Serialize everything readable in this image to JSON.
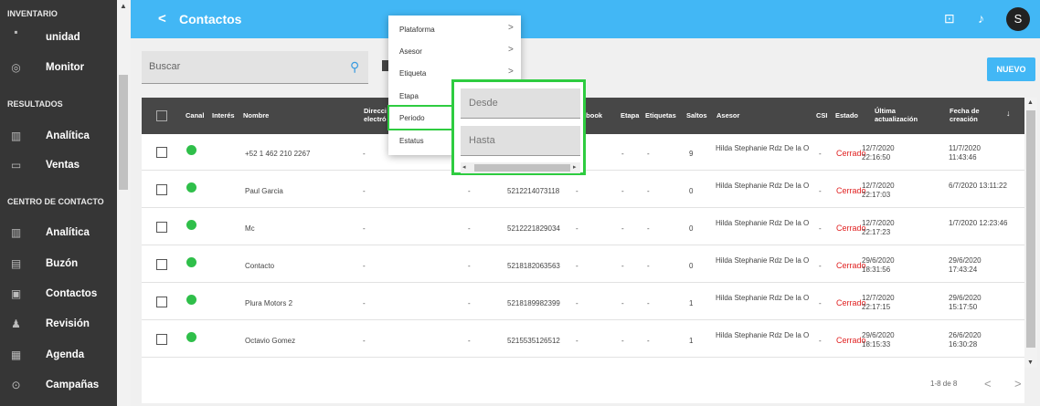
{
  "sidebar": {
    "sections": {
      "inventario": "INVENTARIO",
      "resultados": "RESULTADOS",
      "centro": "CENTRO DE CONTACTO"
    },
    "items": [
      {
        "label": "unidad",
        "icon": "unit-icon"
      },
      {
        "label": "Monitor",
        "icon": "monitor-icon"
      },
      {
        "label": "Analítica",
        "icon": "analytics-icon"
      },
      {
        "label": "Ventas",
        "icon": "car-icon"
      },
      {
        "label": "Analítica",
        "icon": "analytics-icon"
      },
      {
        "label": "Buzón",
        "icon": "inbox-icon"
      },
      {
        "label": "Contactos",
        "icon": "contacts-icon"
      },
      {
        "label": "Revisión",
        "icon": "review-icon"
      },
      {
        "label": "Agenda",
        "icon": "calendar-icon"
      },
      {
        "label": "Campañas",
        "icon": "campaign-icon"
      }
    ]
  },
  "header": {
    "back": "<",
    "title": "Contactos",
    "avatar": "S",
    "accent": "#42b7f5"
  },
  "search": {
    "placeholder": "Buscar"
  },
  "actions": {
    "new": "NUEVO"
  },
  "filter_menu": {
    "items": [
      {
        "label": "Plataforma",
        "chevron": ">"
      },
      {
        "label": "Asesor",
        "chevron": ">"
      },
      {
        "label": "Etiqueta",
        "chevron": ">"
      },
      {
        "label": "Etapa",
        "chevron": ""
      },
      {
        "label": "Periodo",
        "chevron": ""
      },
      {
        "label": "Estatus",
        "chevron": ""
      }
    ],
    "selected": "Periodo"
  },
  "period_submenu": {
    "from": "Desde",
    "to": "Hasta"
  },
  "table": {
    "headers": {
      "canal": "Canal",
      "interes": "Interés",
      "nombre": "Nombre",
      "direccion1": "Direcci",
      "direccion2": "electró",
      "facebook": "ebook",
      "etapa": "Etapa",
      "etiquetas": "Etiquetas",
      "saltos": "Saltos",
      "asesor": "Asesor",
      "csi": "CSI",
      "estado": "Estado",
      "ultima1": "Última",
      "ultima2": "actualización",
      "fecha1": "Fecha de",
      "fecha2": "creación"
    },
    "rows": [
      {
        "nombre": "+52 1 462 210 2267",
        "dir": "-",
        "tel": "",
        "tel_dash": "",
        "etapa": "-",
        "etiq": "-",
        "saltos": "9",
        "asesor": "Hilda Stephanie Rdz De la O",
        "csi": "-",
        "estado": "Cerrado",
        "upd_date": "12/7/2020",
        "upd_time": "22:16:50",
        "cre_date": "11/7/2020",
        "cre_time": "11:43:46"
      },
      {
        "nombre": "Paul Garcia",
        "dir": "-",
        "tel": "5212214073118",
        "tel_dash": "-",
        "etapa": "-",
        "etiq": "-",
        "saltos": "0",
        "asesor": "Hilda Stephanie Rdz De la O",
        "csi": "-",
        "estado": "Cerrado",
        "upd_date": "12/7/2020",
        "upd_time": "22:17:03",
        "cre_date": "6/7/2020 13:11:22",
        "cre_time": ""
      },
      {
        "nombre": "Mc",
        "dir": "-",
        "tel": "5212221829034",
        "tel_dash": "-",
        "etapa": "-",
        "etiq": "-",
        "saltos": "0",
        "asesor": "Hilda Stephanie Rdz De la O",
        "csi": "-",
        "estado": "Cerrado",
        "upd_date": "12/7/2020",
        "upd_time": "22:17:23",
        "cre_date": "1/7/2020 12:23:46",
        "cre_time": ""
      },
      {
        "nombre": "Contacto",
        "dir": "-",
        "tel": "5218182063563",
        "tel_dash": "-",
        "etapa": "-",
        "etiq": "-",
        "saltos": "0",
        "asesor": "Hilda Stephanie Rdz De la O",
        "csi": "-",
        "estado": "Cerrado",
        "upd_date": "29/6/2020",
        "upd_time": "18:31:56",
        "cre_date": "29/6/2020",
        "cre_time": "17:43:24"
      },
      {
        "nombre": "Plura Motors 2",
        "dir": "-",
        "tel": "5218189982399",
        "tel_dash": "-",
        "etapa": "-",
        "etiq": "-",
        "saltos": "1",
        "asesor": "Hilda Stephanie Rdz De la O",
        "csi": "-",
        "estado": "Cerrado",
        "upd_date": "12/7/2020",
        "upd_time": "22:17:15",
        "cre_date": "29/6/2020",
        "cre_time": "15:17:50"
      },
      {
        "nombre": "Octavio Gomez",
        "dir": "-",
        "tel": "5215535126512",
        "tel_dash": "-",
        "etapa": "-",
        "etiq": "-",
        "saltos": "1",
        "asesor": "Hilda Stephanie Rdz De la O",
        "csi": "-",
        "estado": "Cerrado",
        "upd_date": "29/6/2020",
        "upd_time": "18:15:33",
        "cre_date": "26/6/2020",
        "cre_time": "16:30:28"
      }
    ]
  },
  "pagination": {
    "text": "1-8 de 8",
    "prev": "<",
    "next": ">"
  }
}
